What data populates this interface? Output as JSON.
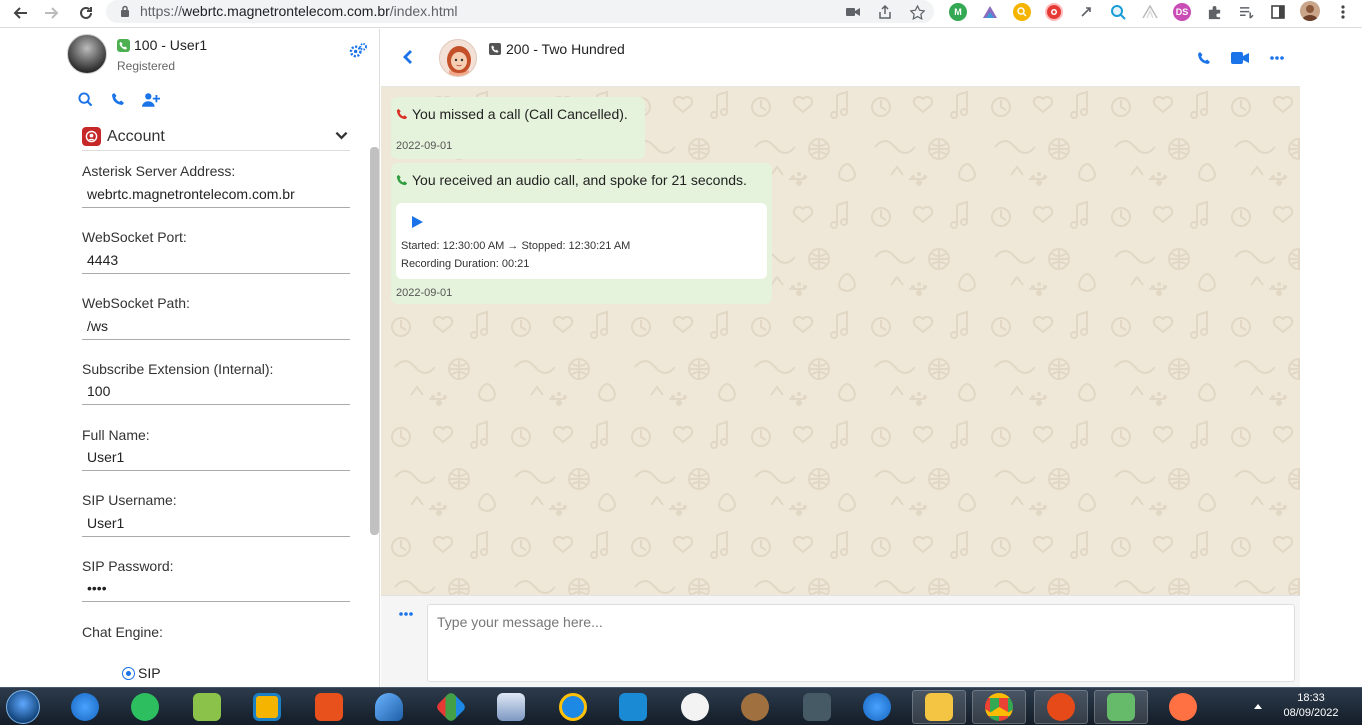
{
  "browser": {
    "url_scheme": "https://",
    "url_host": "webrtc.magnetrontelecom.com.br",
    "url_path": "/index.html"
  },
  "profile": {
    "name": "100 - User1",
    "status": "Registered"
  },
  "account_section": {
    "title": "Account",
    "fields": [
      {
        "label": "Asterisk Server Address:",
        "value": "webrtc.magnetrontelecom.com.br"
      },
      {
        "label": "WebSocket Port:",
        "value": "4443"
      },
      {
        "label": "WebSocket Path:",
        "value": "/ws"
      },
      {
        "label": "Subscribe Extension (Internal):",
        "value": "100"
      },
      {
        "label": "Full Name:",
        "value": "User1"
      },
      {
        "label": "SIP Username:",
        "value": "User1"
      },
      {
        "label": "SIP Password:",
        "value": "••••"
      }
    ],
    "chat_engine_label": "Chat Engine:",
    "chat_engine_option": "SIP"
  },
  "chat": {
    "buddy_name": "200 - Two Hundred",
    "messages": [
      {
        "text": "You missed a call (Call Cancelled).",
        "date": "2022-09-01",
        "icon_color": "#d93025"
      },
      {
        "text": "You received an audio call, and spoke for 21 seconds.",
        "date": "2022-09-01",
        "icon_color": "#2e9d3e",
        "recording": {
          "times": "Started: 12:30:00 AM → Stopped: 12:30:21 AM",
          "duration": "Recording Duration: 00:21"
        }
      }
    ],
    "composer_placeholder": "Type your message here..."
  },
  "colors": {
    "accent": "#1a73e8",
    "bubble": "#e6f3dc",
    "chat_bg": "#efe7d8"
  },
  "taskbar": {
    "time": "18:33",
    "date": "08/09/2022"
  }
}
